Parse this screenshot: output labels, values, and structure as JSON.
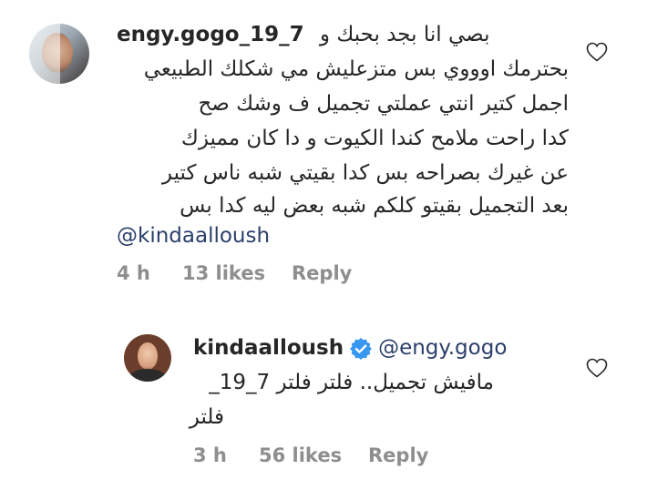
{
  "comment1": {
    "username": "engy.gogo_19_7",
    "lines": [
      "بصي انا بجد بحبك و",
      "بحترمك اوووي بس متزعليش مي شكلك الطبيعي",
      "اجمل كتير انتي عملتي تجميل ف وشك صح",
      "كدا راحت ملامح كندا الكيوت و دا كان مميزك",
      "عن غيرك بصراحه بس كدا بقيتي شبه ناس كتير",
      "بعد التجميل بقيتو كلكم شبه بعض ليه كدا بس"
    ],
    "mention": "@kindaalloush",
    "time": "4 h",
    "likes": "13 likes",
    "reply": "Reply"
  },
  "comment2": {
    "username": "kindaalloush",
    "mention": "@engy.gogo",
    "lines": [
      "مافيش تجميل.. فلتر فلتر 7_19_",
      "فلتر"
    ],
    "time": "3 h",
    "likes": "56 likes",
    "reply": "Reply"
  },
  "icons": {
    "like": "heart-outline-icon",
    "verified": "verified-badge-icon"
  },
  "colors": {
    "text": "#262626",
    "meta": "#8e8e8e",
    "mention": "#2b3f6b",
    "verified": "#3897f0"
  }
}
